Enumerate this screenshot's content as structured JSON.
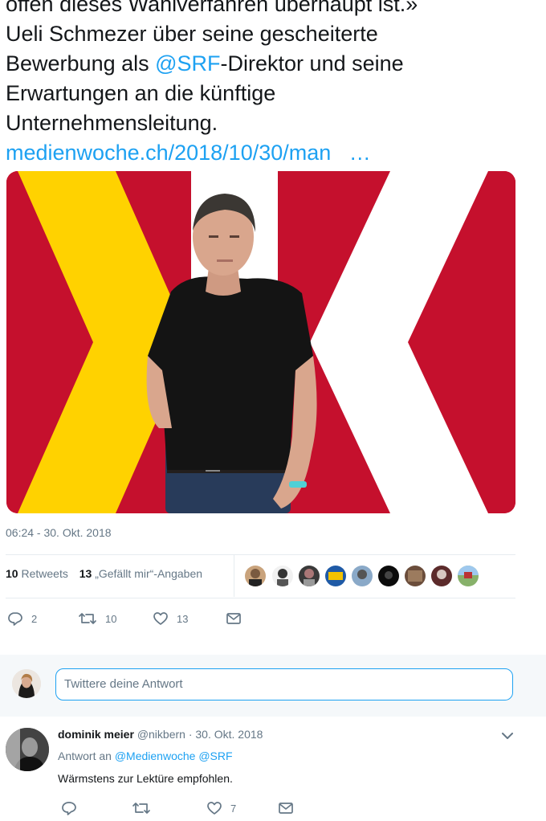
{
  "tweet": {
    "lines": [
      "offen dieses Wahlverfahren überhaupt ist.»",
      "Ueli Schmezer über seine gescheiterte",
      "Bewerbung als ",
      "-Direktor und seine",
      "Erwartungen an die künftige",
      "Unternehmensleitung."
    ],
    "mention": "@SRF",
    "link": "medienwoche.ch/2018/10/30/man",
    "link_ellipsis": "…",
    "timestamp": "06:24 - 30. Okt. 2018"
  },
  "stats": {
    "retweets_count": "10",
    "retweets_label": "Retweets",
    "likes_count": "13",
    "likes_label": "„Gefällt mir“-Angaben"
  },
  "actions": {
    "reply_count": "2",
    "retweet_count": "10",
    "like_count": "13"
  },
  "reply_box": {
    "placeholder": "Twittere deine Antwort"
  },
  "reply": {
    "name": "dominik meier",
    "handle": "@nikbern",
    "date": " · 30. Okt. 2018",
    "reply_to_prefix": "Antwort an ",
    "reply_to_1": "@Medienwoche",
    "reply_to_2": "@SRF",
    "text": "Wärmstens zur Lektüre empfohlen.",
    "like_count": "7"
  },
  "colors": {
    "accent": "#1da1f2",
    "media_red": "#c5102d",
    "media_yellow": "#ffd200"
  }
}
